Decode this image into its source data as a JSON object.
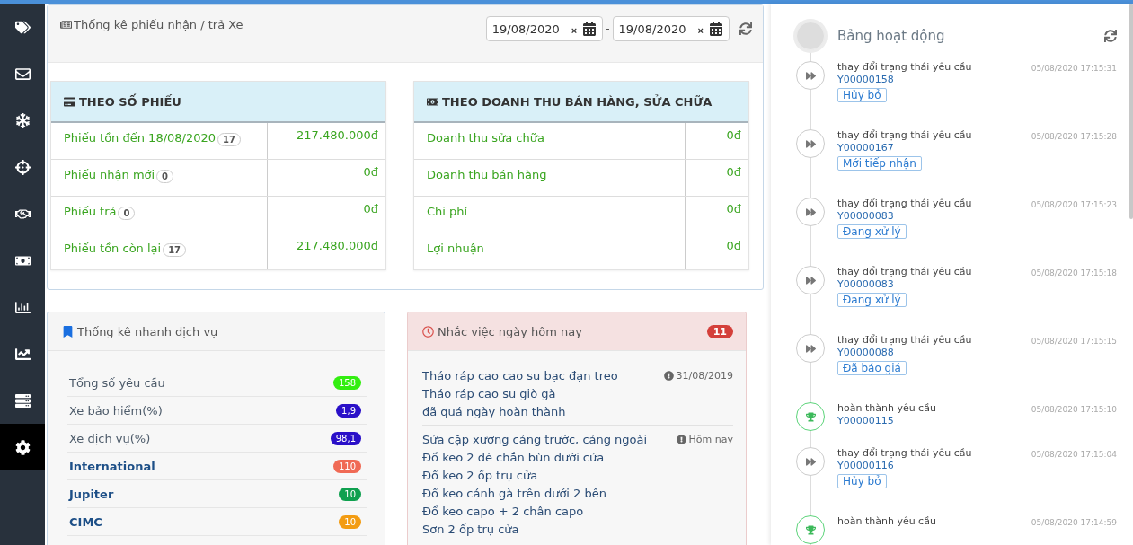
{
  "sidebar": {
    "items": [
      {
        "selected": false
      },
      {
        "selected": false
      },
      {
        "selected": false
      },
      {
        "selected": false
      },
      {
        "selected": false
      },
      {
        "selected": false
      },
      {
        "selected": false
      },
      {
        "selected": false
      },
      {
        "selected": false
      },
      {
        "selected": true
      }
    ]
  },
  "summary": {
    "title": "Thống kê phiếu nhận / trả Xe",
    "date_from": "19/08/2020",
    "date_to": "19/08/2020",
    "clear_label": "×",
    "separator": "-",
    "tables": [
      {
        "title": "THEO SỐ PHIẾU",
        "rows": [
          {
            "label": "Phiếu tồn đến 18/08/2020",
            "badge": "17",
            "value": "217.480.000đ"
          },
          {
            "label": "Phiếu nhận mới",
            "badge": "0",
            "value": "0đ"
          },
          {
            "label": "Phiếu trả",
            "badge": "0",
            "value": "0đ"
          },
          {
            "label": "Phiếu tồn còn lại",
            "badge": "17",
            "value": "217.480.000đ"
          }
        ]
      },
      {
        "title": "THEO DOANH THU BÁN HÀNG, SỬA CHỮA",
        "rows": [
          {
            "label": "Doanh thu sửa chữa",
            "value": "0đ"
          },
          {
            "label": "Doanh thu bán hàng",
            "value": "0đ"
          },
          {
            "label": "Chi phí",
            "value": "0đ"
          },
          {
            "label": "Lợi nhuận",
            "value": "0đ"
          }
        ]
      }
    ]
  },
  "services": {
    "title": "Thống kê nhanh dịch vụ",
    "items": [
      {
        "kind": "metric",
        "label": "Tổng số yêu cầu",
        "count": "158",
        "color": "#33ee11"
      },
      {
        "kind": "metric",
        "label": "Xe bảo hiểm(%)",
        "count": "1,9",
        "color": "#2a10c8"
      },
      {
        "kind": "metric",
        "label": "Xe dịch vụ(%)",
        "count": "98,1",
        "color": "#2a10c8"
      },
      {
        "kind": "brand",
        "label": "International",
        "count": "110",
        "color": "#f06a55"
      },
      {
        "kind": "brand",
        "label": "Jupiter",
        "count": "10",
        "color": "#0fa04f"
      },
      {
        "kind": "brand",
        "label": "CIMC",
        "count": "10",
        "color": "#f39c12"
      }
    ]
  },
  "reminders": {
    "title": "Nhắc việc ngày hôm nay",
    "count": "11",
    "groups": [
      {
        "lines": [
          "Tháo ráp cao cao su bạc đạn treo",
          "Tháo ráp cao su giò gà",
          "đã quá ngày hoàn thành"
        ],
        "note": "31/08/2019"
      },
      {
        "lines": [
          "Sửa cặp xương cảng trước, cảng ngoài",
          "Đổ keo 2 dè chắn bùn dưới cửa",
          "Đổ keo 2 ốp trụ cửa",
          "Đổ keo cánh gà trên dưới 2 bên",
          "Đổ keo capo + 2 chân capo",
          "Sơn 2 ốp trụ cửa"
        ],
        "note": "Hôm nay"
      }
    ]
  },
  "activity": {
    "title": "Bảng hoạt động",
    "entries": [
      {
        "kind": "status",
        "action": "thay đổi trạng thái yêu cầu",
        "code": "Y00000158",
        "status": "Hủy bỏ",
        "time": "05/08/2020 17:15:31"
      },
      {
        "kind": "status",
        "action": "thay đổi trạng thái yêu cầu",
        "code": "Y00000167",
        "status": "Mới tiếp nhận",
        "time": "05/08/2020 17:15:28"
      },
      {
        "kind": "status",
        "action": "thay đổi trạng thái yêu cầu",
        "code": "Y00000083",
        "status": "Đang xử lý",
        "time": "05/08/2020 17:15:23"
      },
      {
        "kind": "status",
        "action": "thay đổi trạng thái yêu cầu",
        "code": "Y00000083",
        "status": "Đang xử lý",
        "time": "05/08/2020 17:15:18"
      },
      {
        "kind": "status",
        "action": "thay đổi trạng thái yêu cầu",
        "code": "Y00000088",
        "status": "Đã báo giá",
        "time": "05/08/2020 17:15:15"
      },
      {
        "kind": "complete",
        "action": "hoàn thành yêu cầu",
        "code": "Y00000115",
        "time": "05/08/2020 17:15:10"
      },
      {
        "kind": "status",
        "action": "thay đổi trạng thái yêu cầu",
        "code": "Y00000116",
        "status": "Hủy bỏ",
        "time": "05/08/2020 17:15:04"
      },
      {
        "kind": "complete",
        "action": "hoàn thành yêu cầu",
        "time": "05/08/2020 17:14:59"
      }
    ]
  }
}
